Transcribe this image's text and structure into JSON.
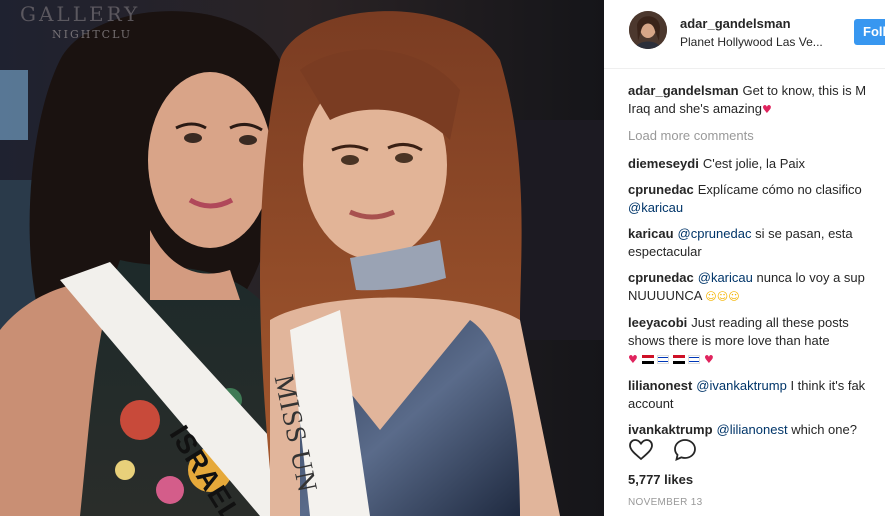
{
  "photo": {
    "sign_text": "GALLERY",
    "sign_sub": "NIGHTCLU",
    "sash_left_text": "ISRAEL",
    "sash_right_text": "MISS UN"
  },
  "header": {
    "username": "adar_gandelsman",
    "location": "Planet Hollywood Las Ve...",
    "follow_label": "Foll"
  },
  "caption": {
    "username": "adar_gandelsman",
    "text_line1": "Get to know, this is M",
    "text_line2": "Iraq and she's amazing"
  },
  "load_more": "Load more comments",
  "comments": [
    {
      "username": "diemeseydi",
      "line1": "C'est jolie, la Paix",
      "line2": ""
    },
    {
      "username": "cprunedac",
      "line1": "Explícame cómo no clasifico",
      "mention2": "@karicau",
      "line2": ""
    },
    {
      "username": "karicau",
      "mention1": "@cprunedac",
      "line1": "si se pasan, esta",
      "line2": "espectacular"
    },
    {
      "username": "cprunedac",
      "mention1": "@karicau",
      "line1": "nunca lo voy a sup",
      "line2": "NUUUUNCA"
    },
    {
      "username": "leeyacobi",
      "line1": "Just reading all these posts",
      "line2": "shows there is more love than hate"
    },
    {
      "username": "lilianonest",
      "mention1": "@ivankaktrump",
      "line1": "I think it's fak",
      "line2": "account"
    },
    {
      "username": "ivankaktrump",
      "mention1": "@lilianonest",
      "line1": "which one?",
      "line2": ""
    }
  ],
  "icons": {
    "like": "heart-outline-icon",
    "comment": "speech-bubble-icon"
  },
  "likes": "5,777 likes",
  "date": "NOVEMBER 13",
  "colors": {
    "follow": "#3897f0",
    "muted": "#999999",
    "heart": "#e0245e"
  }
}
